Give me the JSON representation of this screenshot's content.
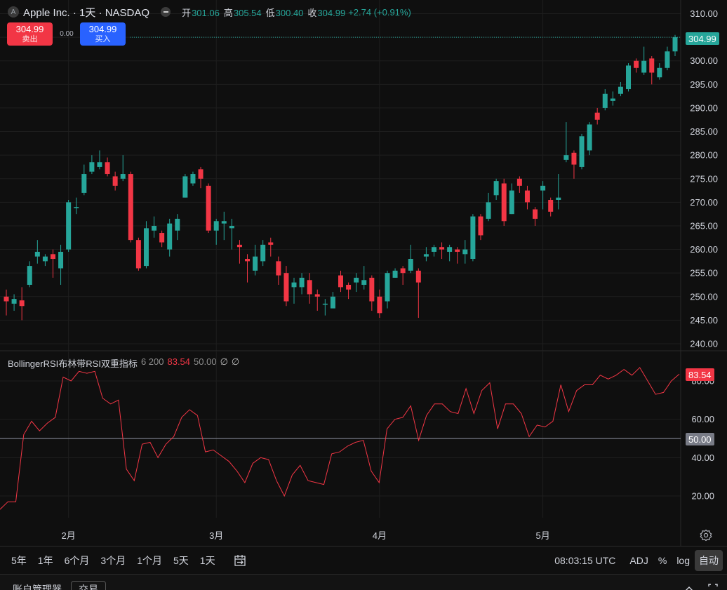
{
  "header": {
    "logo_letter": "A",
    "title": "Apple Inc. · 1天 · NASDAQ",
    "ohlc": [
      {
        "label": "开",
        "value": "301.06"
      },
      {
        "label": "高",
        "value": "305.54"
      },
      {
        "label": "低",
        "value": "300.40"
      },
      {
        "label": "收",
        "value": "304.99"
      }
    ],
    "change": "+2.74 (+0.91%)"
  },
  "trade": {
    "sell_price": "304.99",
    "sell_label": "卖出",
    "spread": "0.00",
    "buy_price": "304.99",
    "buy_label": "买入"
  },
  "colors": {
    "up": "#26a69a",
    "down": "#f23645",
    "rsi": "#f23645",
    "buy": "#2962ff"
  },
  "chart_data": [
    {
      "type": "candlestick",
      "price_axis": {
        "ticks": [
          "310.00",
          "305.00",
          "300.00",
          "295.00",
          "290.00",
          "285.00",
          "280.00",
          "275.00",
          "270.00",
          "265.00",
          "260.00",
          "255.00",
          "250.00",
          "245.00",
          "240.00"
        ],
        "ylim": [
          238,
          311
        ]
      },
      "time_axis": {
        "ticks": [
          {
            "label": "2月",
            "index": 8
          },
          {
            "label": "3月",
            "index": 27
          },
          {
            "label": "4月",
            "index": 48
          },
          {
            "label": "5月",
            "index": 69
          }
        ]
      },
      "last_price": "304.99",
      "candles": [
        [
          250.0,
          249.0,
          251.5,
          246.0
        ],
        [
          248.5,
          249.5,
          250.5,
          247.0
        ],
        [
          249.2,
          248.0,
          252.0,
          245.0
        ],
        [
          252.5,
          256.5,
          257.5,
          252.0
        ],
        [
          258.5,
          259.5,
          262.0,
          257.0
        ],
        [
          257.5,
          258.5,
          259.0,
          256.5
        ],
        [
          259.0,
          258.0,
          260.0,
          254.0
        ],
        [
          256.0,
          259.5,
          261.0,
          252.5
        ],
        [
          260.0,
          270.0,
          270.5,
          259.5
        ],
        [
          269.0,
          269.0,
          271.0,
          267.5
        ],
        [
          272.0,
          276.0,
          278.0,
          271.5
        ],
        [
          276.5,
          278.5,
          280.0,
          276.0
        ],
        [
          277.5,
          278.5,
          281.0,
          277.0
        ],
        [
          278.5,
          276.0,
          279.5,
          275.5
        ],
        [
          275.5,
          273.5,
          276.5,
          272.5
        ],
        [
          275.0,
          276.0,
          280.0,
          274.5
        ],
        [
          276.0,
          262.0,
          276.5,
          261.5
        ],
        [
          262.0,
          256.0,
          262.5,
          255.5
        ],
        [
          256.5,
          264.5,
          266.0,
          256.0
        ],
        [
          264.0,
          265.0,
          267.0,
          262.5
        ],
        [
          263.5,
          261.5,
          264.0,
          260.5
        ],
        [
          260.0,
          265.5,
          266.5,
          258.5
        ],
        [
          264.0,
          266.5,
          267.5,
          262.0
        ],
        [
          271.0,
          275.5,
          276.0,
          271.0
        ],
        [
          274.0,
          276.0,
          276.5,
          273.5
        ],
        [
          277.0,
          275.0,
          277.5,
          273.0
        ],
        [
          273.5,
          264.0,
          274.0,
          263.5
        ],
        [
          264.0,
          266.0,
          266.5,
          261.0
        ],
        [
          265.5,
          266.0,
          268.0,
          262.0
        ],
        [
          264.5,
          265.0,
          266.5,
          260.0
        ],
        [
          261.0,
          260.5,
          262.0,
          257.0
        ],
        [
          258.0,
          257.5,
          259.0,
          253.0
        ],
        [
          255.5,
          258.5,
          261.0,
          254.5
        ],
        [
          257.5,
          261.0,
          262.0,
          256.5
        ],
        [
          261.5,
          261.0,
          262.5,
          258.5
        ],
        [
          257.5,
          254.5,
          258.5,
          252.5
        ],
        [
          255.0,
          249.0,
          256.5,
          248.0
        ],
        [
          252.0,
          253.0,
          254.0,
          248.5
        ],
        [
          252.0,
          254.0,
          255.0,
          250.5
        ],
        [
          253.5,
          250.5,
          255.0,
          248.5
        ],
        [
          250.5,
          250.0,
          251.5,
          247.0
        ],
        [
          248.5,
          248.5,
          249.5,
          246.0
        ],
        [
          247.5,
          250.0,
          251.0,
          248.0
        ],
        [
          254.5,
          252.0,
          255.5,
          251.0
        ],
        [
          252.5,
          251.5,
          253.0,
          249.5
        ],
        [
          253.0,
          254.0,
          255.0,
          251.0
        ],
        [
          252.5,
          253.5,
          256.5,
          251.5
        ],
        [
          254.0,
          249.0,
          254.5,
          247.0
        ],
        [
          250.0,
          246.5,
          251.5,
          245.5
        ],
        [
          249.0,
          255.0,
          255.5,
          247.5
        ],
        [
          254.0,
          255.5,
          256.0,
          254.0
        ],
        [
          256.0,
          255.0,
          256.5,
          252.5
        ],
        [
          255.5,
          258.0,
          261.0,
          255.0
        ],
        [
          255.5,
          253.0,
          256.0,
          245.5
        ],
        [
          258.5,
          259.0,
          260.5,
          257.5
        ],
        [
          259.5,
          260.5,
          261.0,
          258.5
        ],
        [
          260.5,
          260.0,
          261.5,
          258.0
        ],
        [
          259.5,
          260.5,
          261.0,
          257.5
        ],
        [
          260.0,
          259.5,
          260.5,
          257.0
        ],
        [
          259.0,
          260.0,
          262.0,
          257.0
        ],
        [
          258.0,
          267.0,
          267.5,
          257.5
        ],
        [
          267.0,
          263.0,
          267.5,
          262.0
        ],
        [
          266.5,
          270.0,
          272.0,
          266.0
        ],
        [
          271.5,
          274.5,
          275.0,
          270.5
        ],
        [
          274.0,
          266.0,
          275.0,
          265.0
        ],
        [
          267.5,
          272.5,
          274.0,
          267.5
        ],
        [
          275.0,
          273.5,
          275.5,
          272.0
        ],
        [
          272.5,
          270.0,
          273.5,
          268.5
        ],
        [
          268.5,
          266.5,
          269.0,
          265.0
        ],
        [
          272.5,
          273.5,
          274.5,
          268.5
        ],
        [
          270.5,
          268.0,
          271.0,
          267.0
        ],
        [
          270.5,
          271.0,
          276.0,
          268.5
        ],
        [
          279.0,
          280.0,
          287.0,
          278.5
        ],
        [
          280.5,
          278.0,
          281.0,
          275.0
        ],
        [
          277.5,
          284.0,
          284.5,
          277.0
        ],
        [
          281.0,
          286.5,
          287.0,
          280.0
        ],
        [
          289.0,
          287.5,
          290.0,
          286.5
        ],
        [
          290.0,
          293.0,
          294.0,
          289.5
        ],
        [
          291.5,
          292.0,
          293.5,
          290.5
        ],
        [
          293.0,
          294.5,
          295.5,
          292.5
        ],
        [
          294.0,
          299.0,
          299.5,
          293.5
        ],
        [
          300.0,
          298.5,
          300.5,
          297.5
        ],
        [
          297.5,
          300.0,
          303.0,
          297.0
        ],
        [
          300.5,
          297.5,
          301.0,
          295.0
        ],
        [
          296.5,
          298.5,
          299.5,
          296.0
        ],
        [
          298.5,
          302.0,
          303.0,
          298.0
        ],
        [
          302.0,
          305.0,
          305.5,
          301.0
        ]
      ]
    },
    {
      "type": "line",
      "title": "BollingerRSI布林带RSI双重指标",
      "params": "6 200",
      "value1": "83.54",
      "value2": "50.00",
      "na1": "∅",
      "na2": "∅",
      "y_ticks": [
        "80.00",
        "60.00",
        "40.00",
        "20.00"
      ],
      "ylim": [
        10,
        90
      ],
      "baseline": 50,
      "last_value": "83.54",
      "values": [
        13,
        17,
        17,
        52,
        59,
        54,
        58,
        61,
        82,
        80,
        85,
        84,
        85,
        71,
        68,
        70,
        34,
        28,
        47,
        48,
        40,
        47,
        51,
        61,
        65,
        62,
        43,
        44,
        41,
        38,
        33,
        27,
        37,
        40,
        39,
        28,
        20,
        31,
        36,
        28,
        27,
        26,
        42,
        43,
        46,
        48,
        49,
        33,
        27,
        55,
        60,
        61,
        67,
        49,
        62,
        68,
        68,
        64,
        63,
        76,
        63,
        75,
        79,
        55,
        68,
        68,
        63,
        51,
        57,
        56,
        59,
        78,
        64,
        75,
        78,
        78,
        83,
        81,
        83,
        86,
        83,
        87,
        80,
        73,
        74,
        80,
        83.54
      ]
    }
  ],
  "bottom": {
    "ranges": [
      "5年",
      "1年",
      "6个月",
      "3个月",
      "1个月",
      "5天",
      "1天"
    ],
    "time": "08:03:15 UTC",
    "adj": "ADJ",
    "percent": "%",
    "log": "log",
    "auto": "自动"
  },
  "footer": {
    "tab1": "账户管理器",
    "tab2": "交易"
  }
}
